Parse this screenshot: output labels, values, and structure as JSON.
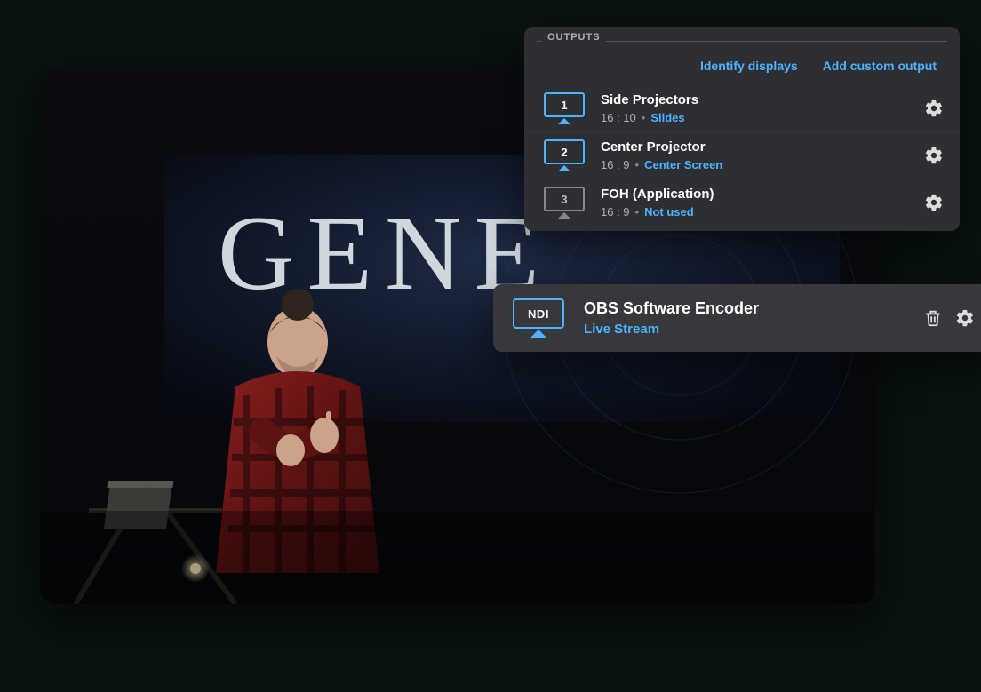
{
  "panel": {
    "label": "OUTPUTS",
    "actions": {
      "identify": "Identify displays",
      "add": "Add custom output"
    },
    "rows": [
      {
        "num": "1",
        "title": "Side Projectors",
        "ratio": "16 : 10",
        "mode": "Slides",
        "active": true
      },
      {
        "num": "2",
        "title": "Center Projector",
        "ratio": "16 : 9",
        "mode": "Center Screen",
        "active": true
      },
      {
        "num": "3",
        "title": "FOH (Application)",
        "ratio": "16 : 9",
        "mode": "Not used",
        "active": false
      }
    ]
  },
  "ndi": {
    "badge": "NDI",
    "title": "OBS Software Encoder",
    "mode": "Live Stream"
  },
  "backdrop": {
    "text": "GENE"
  },
  "glyph": {
    "dot": "•"
  }
}
